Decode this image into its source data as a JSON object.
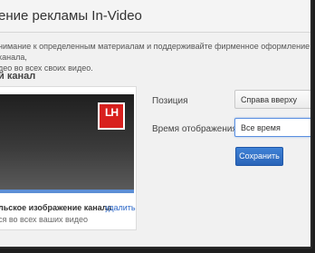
{
  "dialog": {
    "title": "ение рекламы In-Video",
    "description_line1": "нимание к определенным материалам и поддерживайте фирменное оформление канала,",
    "description_line2": "део во всех своих видео."
  },
  "section": {
    "title": "й канал"
  },
  "preview": {
    "logo_text": "LH",
    "caption_title": "льское изображение канала",
    "delete_link": "удалить",
    "caption_sub": "ся во всех ваших видео"
  },
  "settings": {
    "position_label": "Позиция",
    "position_value": "Справа вверху",
    "display_time_label": "Время отображения",
    "display_time_value": "Все время",
    "save_label": "Сохранить"
  },
  "colors": {
    "accent": "#2a64b8",
    "logo": "#d8201e",
    "video_bar": "#5c8fd6"
  }
}
